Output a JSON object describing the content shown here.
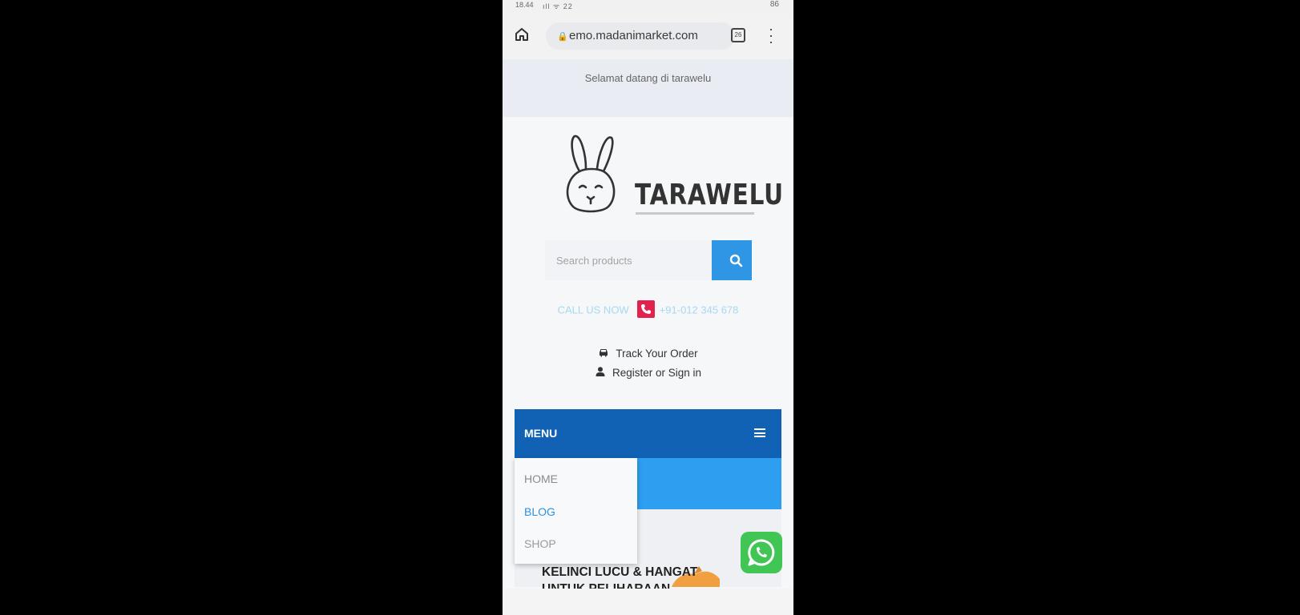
{
  "status_bar": {
    "time": "18.44",
    "signal": "ıll ᯤ 22",
    "battery": "86"
  },
  "browser": {
    "url": "emo.madanimarket.com",
    "tab_count": "26"
  },
  "site": {
    "welcome": "Selamat datang di tarawelu",
    "brand": "TARAWELU",
    "search": {
      "placeholder": "Search products"
    },
    "call": {
      "label": "CALL US NOW",
      "number": "+91-012 345 678"
    },
    "account_links": [
      {
        "label": "Track Your Order",
        "icon": "car-icon"
      },
      {
        "label": "Register or Sign in",
        "icon": "user-icon"
      }
    ],
    "menu": {
      "label": "MENU",
      "items": [
        "HOME",
        "BLOG",
        "SHOP"
      ],
      "active": "BLOG"
    },
    "banner": {
      "line1": "KELINCI LUCU & HANGAT",
      "line2": "UNTUK PELIHARAAN"
    }
  },
  "colors": {
    "menu_bar": "#1162b4",
    "accent_blue": "#2e9ef0",
    "call_red": "#e0224c",
    "whatsapp": "#41c554",
    "active_menu": "#2f8fd8"
  }
}
